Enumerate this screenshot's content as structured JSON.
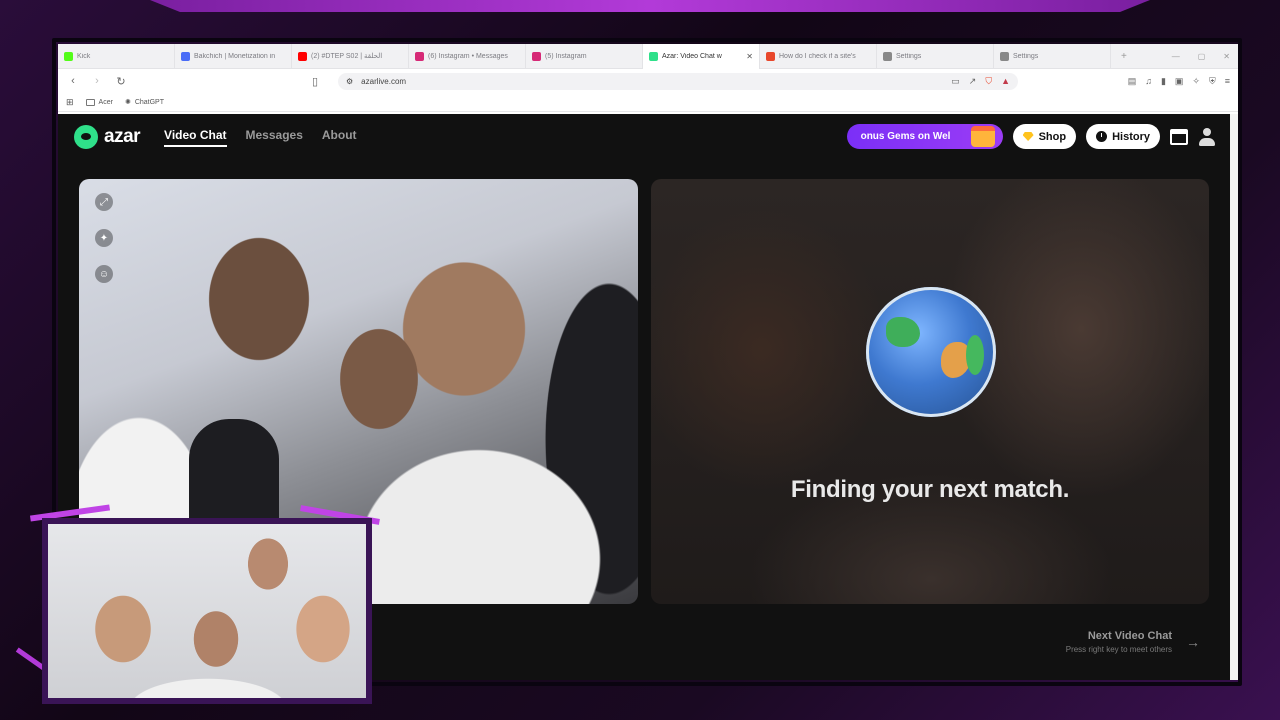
{
  "tabs": [
    {
      "title": "Kick",
      "color": "#53fc18",
      "active": false
    },
    {
      "title": "Bakchich | Monetization in",
      "color": "#4a6cf7",
      "active": false
    },
    {
      "title": "(2) #DTEP S02 | الحلقة",
      "color": "#ff0000",
      "active": false
    },
    {
      "title": "(6) Instagram • Messages",
      "color": "#d62976",
      "active": false
    },
    {
      "title": "(5) Instagram",
      "color": "#d62976",
      "active": false
    },
    {
      "title": "Azar: Video Chat w",
      "color": "#2fe08a",
      "active": true
    },
    {
      "title": "How do I check if a site's",
      "color": "#e8472b",
      "active": false
    },
    {
      "title": "Settings",
      "color": "#888888",
      "active": false
    },
    {
      "title": "Settings",
      "color": "#888888",
      "active": false
    }
  ],
  "tab_close": "✕",
  "tab_add": "+",
  "window_controls": {
    "minimize": "—",
    "maximize": "▢",
    "close": "✕"
  },
  "url": "azarlive.com",
  "bookmarks": [
    {
      "label": "Acer"
    },
    {
      "label": "ChatGPT"
    }
  ],
  "site": {
    "logo": "azar",
    "nav": [
      {
        "label": "Video Chat",
        "active": true
      },
      {
        "label": "Messages",
        "active": false
      },
      {
        "label": "About",
        "active": false
      }
    ],
    "promo": "onus Gems on Wel",
    "shop": "Shop",
    "history": "History"
  },
  "match": {
    "status": "Finding your next match."
  },
  "next": {
    "title": "Next Video Chat",
    "subtitle": "Press right key to meet others",
    "arrow": "→"
  },
  "colors": {
    "accent": "#2fe08a",
    "promo": "#7b2ff7",
    "frame": "#3a1456"
  }
}
